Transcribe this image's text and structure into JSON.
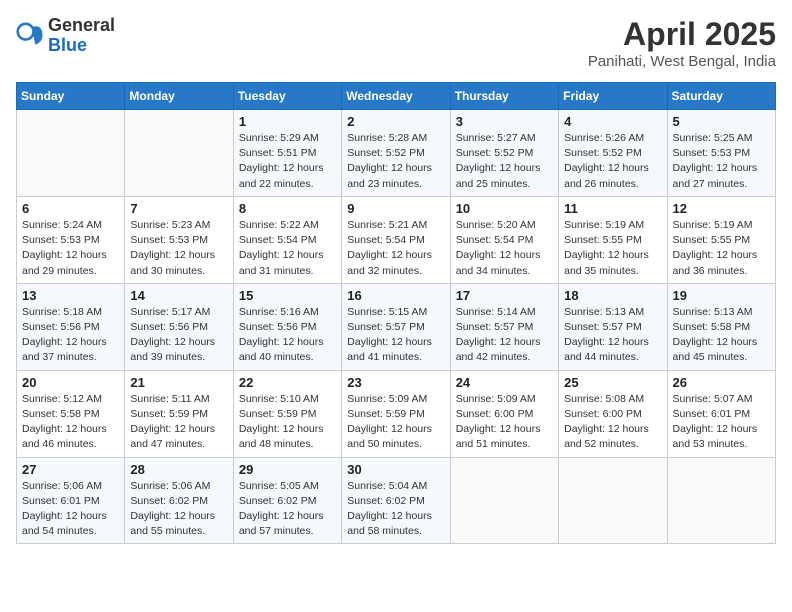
{
  "header": {
    "logo_general": "General",
    "logo_blue": "Blue",
    "month_title": "April 2025",
    "location": "Panihati, West Bengal, India"
  },
  "weekdays": [
    "Sunday",
    "Monday",
    "Tuesday",
    "Wednesday",
    "Thursday",
    "Friday",
    "Saturday"
  ],
  "weeks": [
    [
      {
        "day": "",
        "info": ""
      },
      {
        "day": "",
        "info": ""
      },
      {
        "day": "1",
        "info": "Sunrise: 5:29 AM\nSunset: 5:51 PM\nDaylight: 12 hours and 22 minutes."
      },
      {
        "day": "2",
        "info": "Sunrise: 5:28 AM\nSunset: 5:52 PM\nDaylight: 12 hours and 23 minutes."
      },
      {
        "day": "3",
        "info": "Sunrise: 5:27 AM\nSunset: 5:52 PM\nDaylight: 12 hours and 25 minutes."
      },
      {
        "day": "4",
        "info": "Sunrise: 5:26 AM\nSunset: 5:52 PM\nDaylight: 12 hours and 26 minutes."
      },
      {
        "day": "5",
        "info": "Sunrise: 5:25 AM\nSunset: 5:53 PM\nDaylight: 12 hours and 27 minutes."
      }
    ],
    [
      {
        "day": "6",
        "info": "Sunrise: 5:24 AM\nSunset: 5:53 PM\nDaylight: 12 hours and 29 minutes."
      },
      {
        "day": "7",
        "info": "Sunrise: 5:23 AM\nSunset: 5:53 PM\nDaylight: 12 hours and 30 minutes."
      },
      {
        "day": "8",
        "info": "Sunrise: 5:22 AM\nSunset: 5:54 PM\nDaylight: 12 hours and 31 minutes."
      },
      {
        "day": "9",
        "info": "Sunrise: 5:21 AM\nSunset: 5:54 PM\nDaylight: 12 hours and 32 minutes."
      },
      {
        "day": "10",
        "info": "Sunrise: 5:20 AM\nSunset: 5:54 PM\nDaylight: 12 hours and 34 minutes."
      },
      {
        "day": "11",
        "info": "Sunrise: 5:19 AM\nSunset: 5:55 PM\nDaylight: 12 hours and 35 minutes."
      },
      {
        "day": "12",
        "info": "Sunrise: 5:19 AM\nSunset: 5:55 PM\nDaylight: 12 hours and 36 minutes."
      }
    ],
    [
      {
        "day": "13",
        "info": "Sunrise: 5:18 AM\nSunset: 5:56 PM\nDaylight: 12 hours and 37 minutes."
      },
      {
        "day": "14",
        "info": "Sunrise: 5:17 AM\nSunset: 5:56 PM\nDaylight: 12 hours and 39 minutes."
      },
      {
        "day": "15",
        "info": "Sunrise: 5:16 AM\nSunset: 5:56 PM\nDaylight: 12 hours and 40 minutes."
      },
      {
        "day": "16",
        "info": "Sunrise: 5:15 AM\nSunset: 5:57 PM\nDaylight: 12 hours and 41 minutes."
      },
      {
        "day": "17",
        "info": "Sunrise: 5:14 AM\nSunset: 5:57 PM\nDaylight: 12 hours and 42 minutes."
      },
      {
        "day": "18",
        "info": "Sunrise: 5:13 AM\nSunset: 5:57 PM\nDaylight: 12 hours and 44 minutes."
      },
      {
        "day": "19",
        "info": "Sunrise: 5:13 AM\nSunset: 5:58 PM\nDaylight: 12 hours and 45 minutes."
      }
    ],
    [
      {
        "day": "20",
        "info": "Sunrise: 5:12 AM\nSunset: 5:58 PM\nDaylight: 12 hours and 46 minutes."
      },
      {
        "day": "21",
        "info": "Sunrise: 5:11 AM\nSunset: 5:59 PM\nDaylight: 12 hours and 47 minutes."
      },
      {
        "day": "22",
        "info": "Sunrise: 5:10 AM\nSunset: 5:59 PM\nDaylight: 12 hours and 48 minutes."
      },
      {
        "day": "23",
        "info": "Sunrise: 5:09 AM\nSunset: 5:59 PM\nDaylight: 12 hours and 50 minutes."
      },
      {
        "day": "24",
        "info": "Sunrise: 5:09 AM\nSunset: 6:00 PM\nDaylight: 12 hours and 51 minutes."
      },
      {
        "day": "25",
        "info": "Sunrise: 5:08 AM\nSunset: 6:00 PM\nDaylight: 12 hours and 52 minutes."
      },
      {
        "day": "26",
        "info": "Sunrise: 5:07 AM\nSunset: 6:01 PM\nDaylight: 12 hours and 53 minutes."
      }
    ],
    [
      {
        "day": "27",
        "info": "Sunrise: 5:06 AM\nSunset: 6:01 PM\nDaylight: 12 hours and 54 minutes."
      },
      {
        "day": "28",
        "info": "Sunrise: 5:06 AM\nSunset: 6:02 PM\nDaylight: 12 hours and 55 minutes."
      },
      {
        "day": "29",
        "info": "Sunrise: 5:05 AM\nSunset: 6:02 PM\nDaylight: 12 hours and 57 minutes."
      },
      {
        "day": "30",
        "info": "Sunrise: 5:04 AM\nSunset: 6:02 PM\nDaylight: 12 hours and 58 minutes."
      },
      {
        "day": "",
        "info": ""
      },
      {
        "day": "",
        "info": ""
      },
      {
        "day": "",
        "info": ""
      }
    ]
  ]
}
